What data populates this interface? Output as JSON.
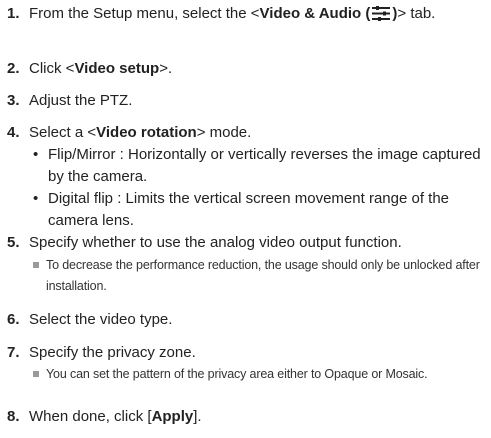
{
  "steps": [
    {
      "num": "1.",
      "pre": "From the Setup menu, select the <",
      "bold": "Video & Audio (",
      "icon": "settings-sliders-icon",
      "bold2": ")",
      "post": "> tab."
    },
    {
      "num": "2.",
      "pre": "Click <",
      "bold": "Video setup",
      "post": ">."
    },
    {
      "num": "3.",
      "text": "Adjust the PTZ."
    },
    {
      "num": "4.",
      "pre": "Select a <",
      "bold": "Video rotation",
      "post": "> mode."
    },
    {
      "num": "5.",
      "text": "Specify whether to use the analog video output function."
    },
    {
      "num": "6.",
      "text": "Select the video type."
    },
    {
      "num": "7.",
      "text": "Specify the privacy zone."
    },
    {
      "num": "8.",
      "pre": "When done, click [",
      "bold": "Apply",
      "post": "]."
    }
  ],
  "bullets": [
    {
      "text": "Flip/Mirror : Horizontally or vertically reverses the image captured by the camera."
    },
    {
      "text": "Digital flip : Limits the vertical screen movement range of the camera lens."
    }
  ],
  "notes": [
    {
      "text": "To decrease the performance reduction, the usage should only be unlocked after installation."
    },
    {
      "text": "You can set the pattern of the privacy area either to Opaque or Mosaic."
    }
  ],
  "colors": {
    "text": "#222222",
    "note_marker": "#9a9a9a"
  }
}
